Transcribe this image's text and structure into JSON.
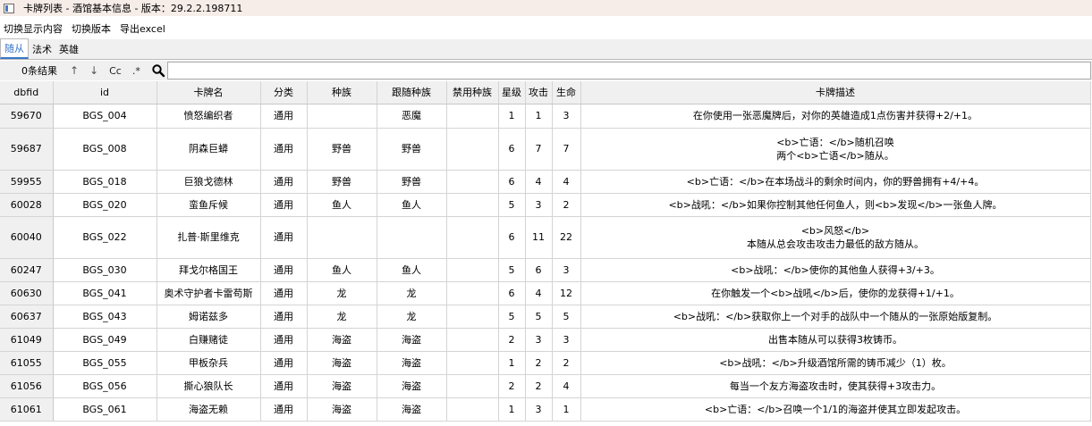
{
  "window": {
    "title": "卡牌列表 - 酒馆基本信息 - 版本：29.2.2.198711"
  },
  "menu": [
    "切换显示内容",
    "切换版本",
    "导出excel"
  ],
  "tabs": [
    {
      "label": "随从",
      "active": true
    },
    {
      "label": "法术",
      "active": false
    },
    {
      "label": "英雄",
      "active": false
    }
  ],
  "search": {
    "result_count": "0条结果",
    "prev_label": "↑",
    "next_label": "↓",
    "case_label": "Cc",
    "regex_label": ".*",
    "value": ""
  },
  "table": {
    "columns": [
      "dbfid",
      "id",
      "卡牌名",
      "分类",
      "种族",
      "跟随种族",
      "禁用种族",
      "星级",
      "攻击",
      "生命",
      "卡牌描述"
    ],
    "rows": [
      {
        "dbfid": "59670",
        "id": "BGS_004",
        "name": "愤怒编织者",
        "category": "通用",
        "race": "",
        "follow_race": "恶魔",
        "banned_race": "",
        "tier": "1",
        "attack": "1",
        "health": "3",
        "desc": "在你使用一张恶魔牌后，对你的英雄造成1点伤害并获得+2/+1。"
      },
      {
        "dbfid": "59687",
        "id": "BGS_008",
        "name": "阴森巨蟒",
        "category": "通用",
        "race": "野兽",
        "follow_race": "野兽",
        "banned_race": "",
        "tier": "6",
        "attack": "7",
        "health": "7",
        "desc": "<b>亡语：</b>随机召唤\n两个<b>亡语</b>随从。"
      },
      {
        "dbfid": "59955",
        "id": "BGS_018",
        "name": "巨狼戈德林",
        "category": "通用",
        "race": "野兽",
        "follow_race": "野兽",
        "banned_race": "",
        "tier": "6",
        "attack": "4",
        "health": "4",
        "desc": "<b>亡语：</b>在本场战斗的剩余时间内，你的野兽拥有+4/+4。"
      },
      {
        "dbfid": "60028",
        "id": "BGS_020",
        "name": "蛮鱼斥候",
        "category": "通用",
        "race": "鱼人",
        "follow_race": "鱼人",
        "banned_race": "",
        "tier": "5",
        "attack": "3",
        "health": "2",
        "desc": "<b>战吼：</b>如果你控制其他任何鱼人，则<b>发现</b>一张鱼人牌。"
      },
      {
        "dbfid": "60040",
        "id": "BGS_022",
        "name": "扎普·斯里维克",
        "category": "通用",
        "race": "",
        "follow_race": "",
        "banned_race": "",
        "tier": "6",
        "attack": "11",
        "health": "22",
        "desc": "<b>风怒</b>\n本随从总会攻击攻击力最低的敌方随从。"
      },
      {
        "dbfid": "60247",
        "id": "BGS_030",
        "name": "拜戈尔格国王",
        "category": "通用",
        "race": "鱼人",
        "follow_race": "鱼人",
        "banned_race": "",
        "tier": "5",
        "attack": "6",
        "health": "3",
        "desc": "<b>战吼：</b>使你的其他鱼人获得+3/+3。"
      },
      {
        "dbfid": "60630",
        "id": "BGS_041",
        "name": "奥术守护者卡雷苟斯",
        "category": "通用",
        "race": "龙",
        "follow_race": "龙",
        "banned_race": "",
        "tier": "6",
        "attack": "4",
        "health": "12",
        "desc": "在你触发一个<b>战吼</b>后，使你的龙获得+1/+1。"
      },
      {
        "dbfid": "60637",
        "id": "BGS_043",
        "name": "姆诺兹多",
        "category": "通用",
        "race": "龙",
        "follow_race": "龙",
        "banned_race": "",
        "tier": "5",
        "attack": "5",
        "health": "5",
        "desc": "<b>战吼：</b>获取你上一个对手的战队中一个随从的一张原始版复制。"
      },
      {
        "dbfid": "61049",
        "id": "BGS_049",
        "name": "白赚赌徒",
        "category": "通用",
        "race": "海盗",
        "follow_race": "海盗",
        "banned_race": "",
        "tier": "2",
        "attack": "3",
        "health": "3",
        "desc": "出售本随从可以获得3枚铸币。"
      },
      {
        "dbfid": "61055",
        "id": "BGS_055",
        "name": "甲板杂兵",
        "category": "通用",
        "race": "海盗",
        "follow_race": "海盗",
        "banned_race": "",
        "tier": "1",
        "attack": "2",
        "health": "2",
        "desc": "<b>战吼：</b>升级酒馆所需的铸币减少（1）枚。"
      },
      {
        "dbfid": "61056",
        "id": "BGS_056",
        "name": "撕心狼队长",
        "category": "通用",
        "race": "海盗",
        "follow_race": "海盗",
        "banned_race": "",
        "tier": "2",
        "attack": "2",
        "health": "4",
        "desc": "每当一个友方海盗攻击时，使其获得+3攻击力。"
      },
      {
        "dbfid": "61061",
        "id": "BGS_061",
        "name": "海盗无赖",
        "category": "通用",
        "race": "海盗",
        "follow_race": "海盗",
        "banned_race": "",
        "tier": "1",
        "attack": "3",
        "health": "1",
        "desc": "<b>亡语：</b>召唤一个1/1的海盗并使其立即发起攻击。"
      }
    ]
  }
}
